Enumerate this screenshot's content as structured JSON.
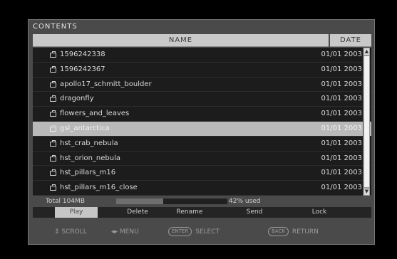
{
  "window": {
    "title": "CONTENTS"
  },
  "columns": {
    "name": "NAME",
    "date": "DATE"
  },
  "files": [
    {
      "name": "1596242338",
      "date": "01/01 2003"
    },
    {
      "name": "1596242367",
      "date": "01/01 2003"
    },
    {
      "name": "apollo17_schmitt_boulder",
      "date": "01/01 2003"
    },
    {
      "name": "dragonfly",
      "date": "01/01 2003"
    },
    {
      "name": "flowers_and_leaves",
      "date": "01/01 2003"
    },
    {
      "name": "gsl_antarctica",
      "date": "01/01 2003"
    },
    {
      "name": "hst_crab_nebula",
      "date": "01/01 2003"
    },
    {
      "name": "hst_orion_nebula",
      "date": "01/01 2003"
    },
    {
      "name": "hst_pillars_m16",
      "date": "01/01 2003"
    },
    {
      "name": "hst_pillars_m16_close",
      "date": "01/01 2003"
    }
  ],
  "selected_index": 5,
  "storage": {
    "total_label": "Total 104MB",
    "used_label": "42% used",
    "used_fraction": 0.42
  },
  "actions": [
    {
      "label": "Play",
      "active": true
    },
    {
      "label": "Delete"
    },
    {
      "label": "Rename"
    },
    {
      "label": "Send"
    },
    {
      "label": "Lock"
    }
  ],
  "help": {
    "scroll": "SCROLL",
    "menu": "MENU",
    "select_key": "ENTER",
    "select": "SELECT",
    "return_key": "BACK",
    "return": "RETURN"
  },
  "icons": {
    "scroll": "updown-arrow-icon",
    "menu": "left-right-arrow-icon",
    "row": "camera-icon"
  }
}
